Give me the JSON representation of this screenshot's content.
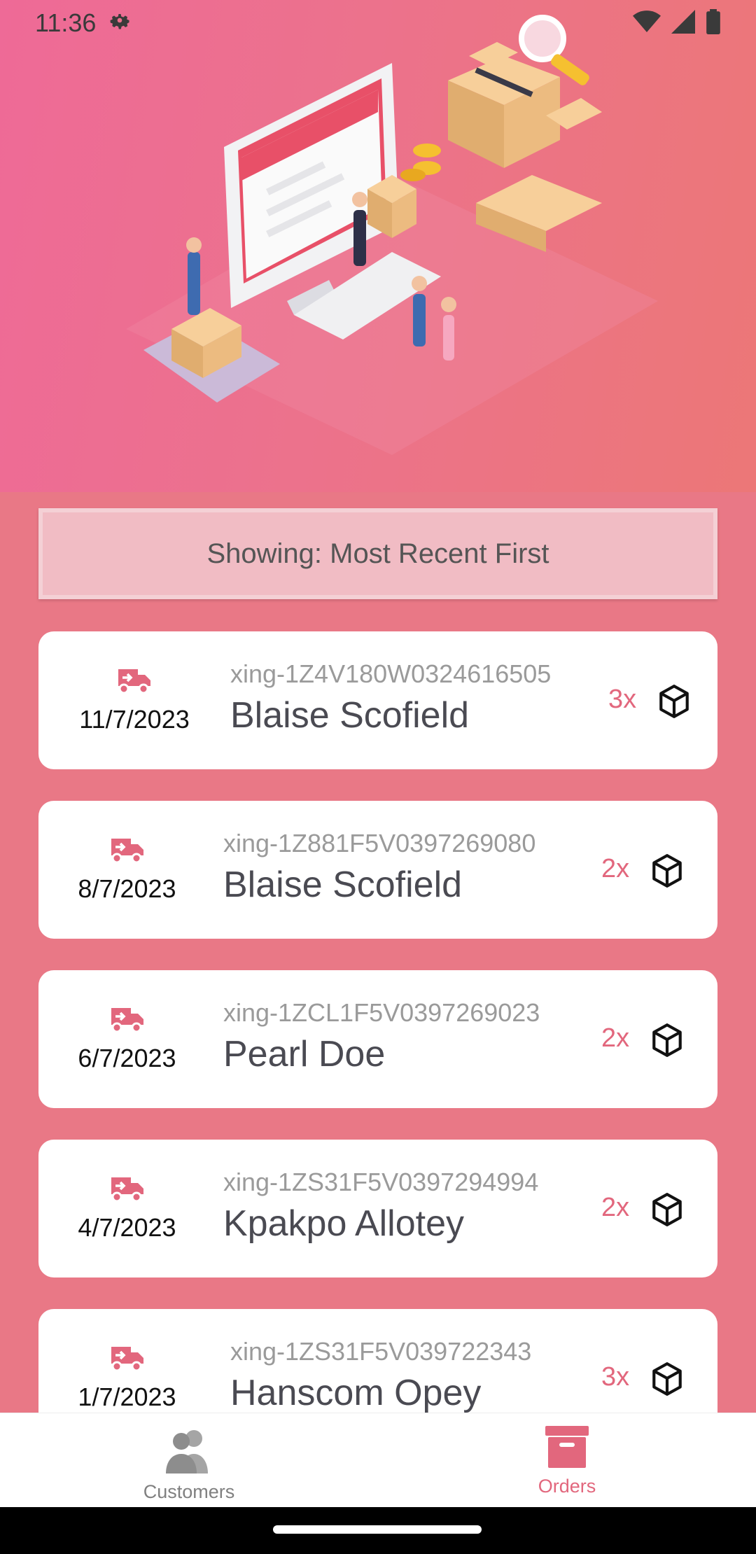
{
  "status_bar": {
    "time": "11:36"
  },
  "sort": {
    "label": "Showing: Most Recent First"
  },
  "orders": [
    {
      "date": "11/7/2023",
      "tracking": "xing-1Z4V180W0324616505",
      "customer": "Blaise Scofield",
      "quantity": "3x"
    },
    {
      "date": "8/7/2023",
      "tracking": "xing-1Z881F5V0397269080",
      "customer": "Blaise Scofield",
      "quantity": "2x"
    },
    {
      "date": "6/7/2023",
      "tracking": "xing-1ZCL1F5V0397269023",
      "customer": "Pearl Doe",
      "quantity": "2x"
    },
    {
      "date": "4/7/2023",
      "tracking": "xing-1ZS31F5V0397294994",
      "customer": "Kpakpo Allotey",
      "quantity": "2x"
    },
    {
      "date": "1/7/2023",
      "tracking": "xing-1ZS31F5V039722343",
      "customer": "Hanscom Opey",
      "quantity": "3x"
    }
  ],
  "nav": {
    "customers_label": "Customers",
    "orders_label": "Orders",
    "active": "orders"
  },
  "colors": {
    "accent": "#e2677d",
    "background": "#e97886",
    "card": "#ffffff",
    "inactive_icon": "#9a9a9a"
  },
  "icons": {
    "status_left": [
      "gear-icon"
    ],
    "status_right": [
      "wifi-icon",
      "signal-icon",
      "battery-icon"
    ],
    "order_row": [
      "delivery-truck-icon",
      "package-box-icon"
    ],
    "nav": [
      "customers-icon",
      "orders-archive-icon"
    ]
  }
}
